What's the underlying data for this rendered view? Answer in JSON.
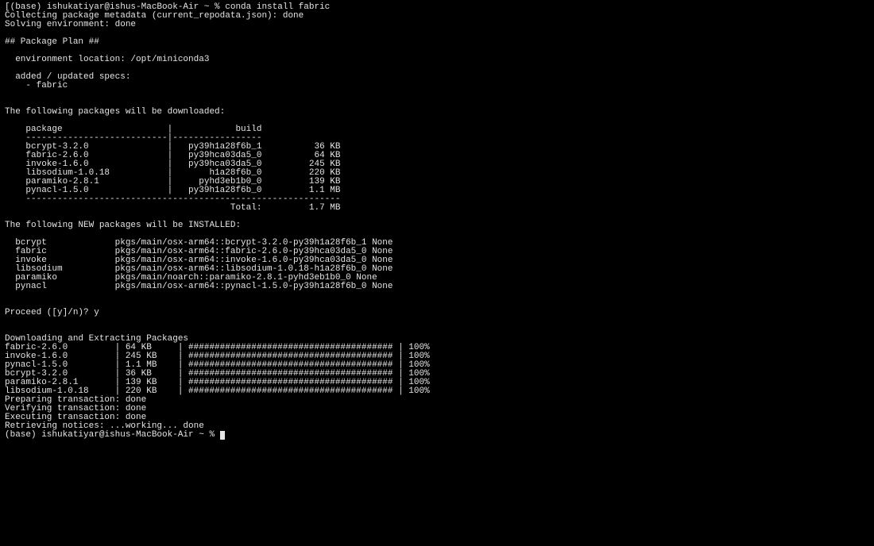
{
  "prompt1": "[(base) ishukatiyar@ishus-MacBook-Air ~ % conda install fabric",
  "collecting": "Collecting package metadata (current_repodata.json): done",
  "solving": "Solving environment: done",
  "planHeader": "## Package Plan ##",
  "envLoc": "  environment location: /opt/miniconda3",
  "specs1": "  added / updated specs:",
  "specs2": "    - fabric",
  "dlHeader": "The following packages will be downloaded:",
  "tblHeader": "    package                    |            build",
  "tblDiv": "    ---------------------------|-----------------",
  "pkgRows": [
    "    bcrypt-3.2.0               |   py39h1a28f6b_1          36 KB",
    "    fabric-2.6.0               |   py39hca03da5_0          64 KB",
    "    invoke-1.6.0               |   py39hca03da5_0         245 KB",
    "    libsodium-1.0.18           |       h1a28f6b_0         220 KB",
    "    paramiko-2.8.1             |     pyhd3eb1b0_0         139 KB",
    "    pynacl-1.5.0               |   py39h1a28f6b_0         1.1 MB"
  ],
  "tblBot": "    ------------------------------------------------------------",
  "tblTotal": "                                           Total:         1.7 MB",
  "installHeader": "The following NEW packages will be INSTALLED:",
  "installRows": [
    "  bcrypt             pkgs/main/osx-arm64::bcrypt-3.2.0-py39h1a28f6b_1 None",
    "  fabric             pkgs/main/osx-arm64::fabric-2.6.0-py39hca03da5_0 None",
    "  invoke             pkgs/main/osx-arm64::invoke-1.6.0-py39hca03da5_0 None",
    "  libsodium          pkgs/main/osx-arm64::libsodium-1.0.18-h1a28f6b_0 None",
    "  paramiko           pkgs/main/noarch::paramiko-2.8.1-pyhd3eb1b0_0 None",
    "  pynacl             pkgs/main/osx-arm64::pynacl-1.5.0-py39h1a28f6b_0 None"
  ],
  "proceed": "Proceed ([y]/n)? y",
  "dlExtract": "Downloading and Extracting Packages",
  "progressRows": [
    "fabric-2.6.0         | 64 KB     | ####################################### | 100%",
    "invoke-1.6.0         | 245 KB    | ####################################### | 100%",
    "pynacl-1.5.0         | 1.1 MB    | ####################################### | 100%",
    "bcrypt-3.2.0         | 36 KB     | ####################################### | 100%",
    "paramiko-2.8.1       | 139 KB    | ####################################### | 100%",
    "libsodium-1.0.18     | 220 KB    | ####################################### | 100%"
  ],
  "prep": "Preparing transaction: done",
  "verify": "Verifying transaction: done",
  "exec": "Executing transaction: done",
  "notices": "Retrieving notices: ...working... done",
  "prompt2": "(base) ishukatiyar@ishus-MacBook-Air ~ % "
}
